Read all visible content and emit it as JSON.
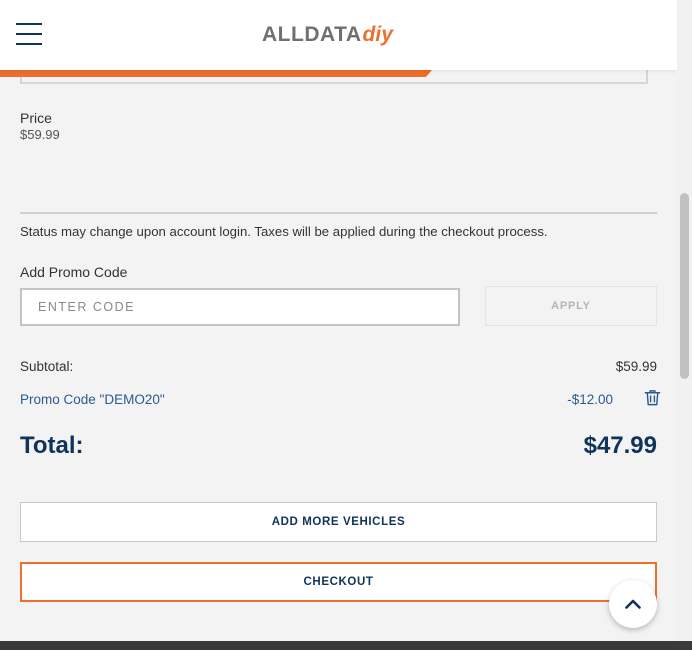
{
  "header": {
    "brand": "ALLDATA",
    "brand_suffix": "diy",
    "menu_icon": "hamburger-menu-icon"
  },
  "item": {
    "price_label": "Price",
    "price_value": "$59.99"
  },
  "status_note": "Status may change upon account login. Taxes will be applied during the checkout process.",
  "promo": {
    "label": "Add Promo Code",
    "placeholder": "ENTER CODE",
    "value": "",
    "apply_label": "APPLY"
  },
  "summary": {
    "subtotal_label": "Subtotal:",
    "subtotal_value": "$59.99",
    "promo_applied": "Promo Code \"DEMO20\"",
    "discount_value": "-$12.00",
    "total_label": "Total:",
    "total_value": "$47.99"
  },
  "actions": {
    "add_vehicles": "ADD MORE VEHICLES",
    "checkout": "CHECKOUT"
  },
  "icons": {
    "remove_promo": "trash-icon",
    "scroll_top": "chevron-up-icon"
  },
  "colors": {
    "accent": "#ee6f2d",
    "navy": "#0f3359",
    "link": "#2d5a8c",
    "background": "#f3f3f3"
  }
}
